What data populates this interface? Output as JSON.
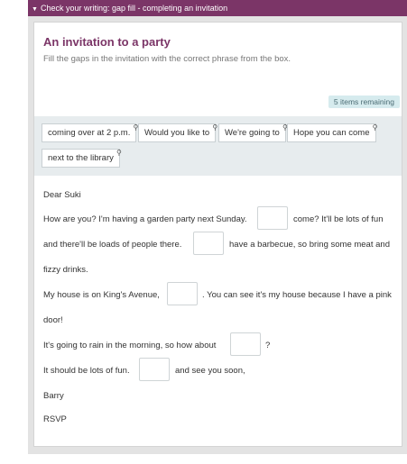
{
  "topbar": {
    "label": "Check your writing: gap fill - completing an invitation"
  },
  "exercise": {
    "title": "An invitation to a party",
    "instructions": "Fill the gaps in the invitation with the correct phrase from the box.",
    "remaining": "5 items remaining"
  },
  "phrases": [
    "coming over at 2 p.m.",
    "Would you like to",
    "We're going to",
    "Hope you can come",
    "next to the library"
  ],
  "letter": {
    "greeting": "Dear Suki",
    "l1a": "How are you? I'm having a garden party next Sunday.",
    "l1b": "come? It'll be lots of fun",
    "l2a": "and there'll be loads of people there.",
    "l2b": "have a barbecue, so bring some meat and",
    "l3": "fizzy drinks.",
    "l4a": "My house is on King's Avenue,",
    "l4b": ". You can see it's my house because I have a pink",
    "l5": "door!",
    "l6a": "It's going to rain in the morning, so how about",
    "l6b": "?",
    "l7a": "It should be lots of fun.",
    "l7b": "and see you soon,",
    "signoff": "Barry",
    "rsvp": "RSVP"
  }
}
